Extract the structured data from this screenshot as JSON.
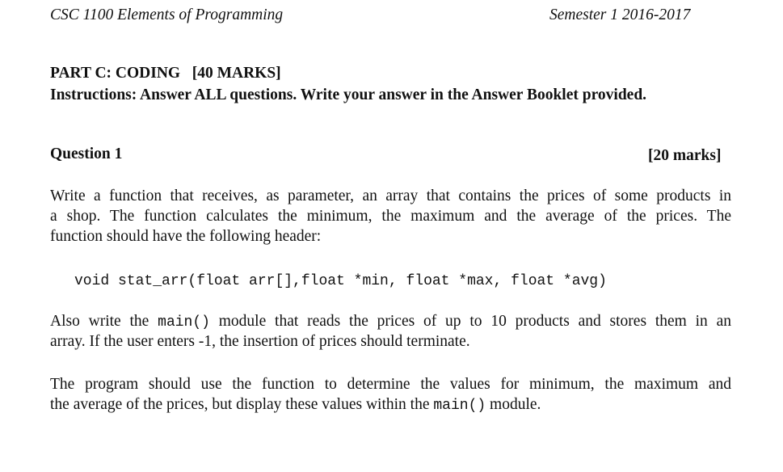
{
  "header": {
    "course": "CSC 1100 Elements of Programming",
    "semester": "Semester 1  2016-2017"
  },
  "part": {
    "title": "PART C: CODING",
    "marks": "[40 MARKS]",
    "instructions": "Instructions: Answer ALL questions. Write your answer in the Answer Booklet provided."
  },
  "question": {
    "title": "Question 1",
    "marks": "[20 marks]"
  },
  "para1": [
    "Write a function that receives, as parameter, an array that contains the prices of some products in",
    "a shop. The function calculates the minimum, the maximum and the average of the prices. The",
    "function should have the following header:"
  ],
  "code_header": "void stat_arr(float arr[],float *min, float *max, float *avg)",
  "para2": {
    "l1_a": "Also write the ",
    "l1_code": "main()",
    "l1_b": " module that reads the prices of up to 10 products and stores them in an",
    "l2": "array. If the user enters -1, the insertion of prices should terminate."
  },
  "para3": {
    "l1": "The program should use the function to determine the values for minimum, the maximum and",
    "l2_a": "the average of the prices, but display these values within the ",
    "l2_code": "main()",
    "l2_b": " module."
  }
}
